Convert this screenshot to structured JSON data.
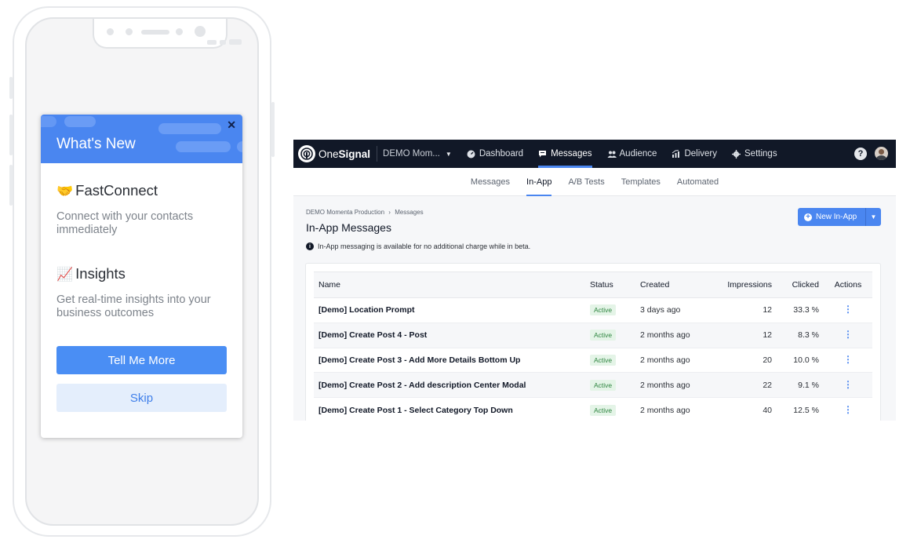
{
  "phone": {
    "modal": {
      "title": "What's New",
      "close_glyph": "✕",
      "features": [
        {
          "emoji": "🤝",
          "title": "FastConnect",
          "description": "Connect with your contacts immediately"
        },
        {
          "emoji": "📈",
          "title": "Insights",
          "description": "Get real-time insights into your business outcomes"
        }
      ],
      "primary_button": "Tell Me More",
      "secondary_button": "Skip"
    }
  },
  "app": {
    "brand": {
      "light": "One",
      "bold": "Signal"
    },
    "app_selector": "DEMO Mom...",
    "nav": [
      {
        "label": "Dashboard",
        "icon": "dashboard-icon"
      },
      {
        "label": "Messages",
        "icon": "messages-icon"
      },
      {
        "label": "Audience",
        "icon": "audience-icon"
      },
      {
        "label": "Delivery",
        "icon": "delivery-icon"
      },
      {
        "label": "Settings",
        "icon": "settings-icon"
      }
    ],
    "active_nav": "Messages",
    "help_glyph": "?",
    "subnav": [
      "Messages",
      "In-App",
      "A/B Tests",
      "Templates",
      "Automated"
    ],
    "active_subnav": "In-App",
    "breadcrumb": {
      "parent": "DEMO Momenta Production",
      "separator": "›",
      "current": "Messages"
    },
    "page_title": "In-App Messages",
    "info_text": "In-App messaging is available for no additional charge while in beta.",
    "new_button": "New In-App",
    "accent_color": "#4a86f0",
    "table": {
      "columns": [
        "Name",
        "Status",
        "Created",
        "Impressions",
        "Clicked",
        "Actions"
      ],
      "rows": [
        {
          "name": "[Demo] Location Prompt",
          "status": "Active",
          "created": "3 days ago",
          "impressions": "12",
          "clicked": "33.3 %"
        },
        {
          "name": "[Demo] Create Post 4 - Post",
          "status": "Active",
          "created": "2 months ago",
          "impressions": "12",
          "clicked": "8.3 %"
        },
        {
          "name": "[Demo] Create Post 3 - Add More Details Bottom Up",
          "status": "Active",
          "created": "2 months ago",
          "impressions": "20",
          "clicked": "10.0 %"
        },
        {
          "name": "[Demo] Create Post 2 - Add description Center Modal",
          "status": "Active",
          "created": "2 months ago",
          "impressions": "22",
          "clicked": "9.1 %"
        },
        {
          "name": "[Demo] Create Post 1 - Select Category Top Down",
          "status": "Active",
          "created": "2 months ago",
          "impressions": "40",
          "clicked": "12.5 %"
        }
      ]
    }
  }
}
